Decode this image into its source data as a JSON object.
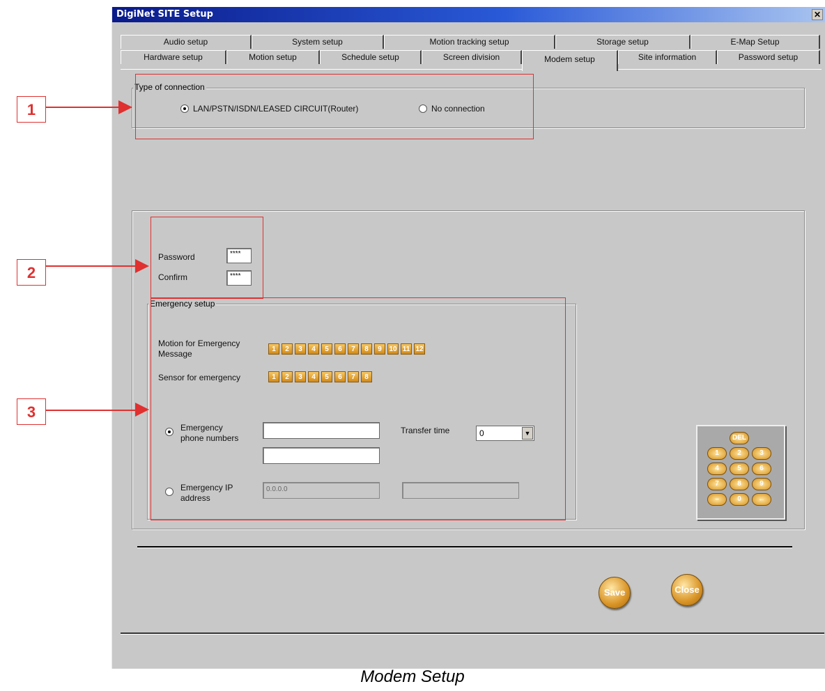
{
  "window": {
    "title": "DigiNet SITE Setup",
    "close_glyph": "✕"
  },
  "tabs_row1": [
    "Audio setup",
    "System setup",
    "Motion tracking setup",
    "Storage setup",
    "E-Map Setup"
  ],
  "tabs_row2": [
    "Hardware setup",
    "Motion setup",
    "Schedule setup",
    "Screen division",
    "Modem setup",
    "Site information",
    "Password setup"
  ],
  "active_tab": "Modem setup",
  "connection": {
    "group_title": "Type of connection",
    "option_lan": "LAN/PSTN/ISDN/LEASED CIRCUIT(Router)",
    "option_none": "No connection",
    "selected": "LAN/PSTN/ISDN/LEASED CIRCUIT(Router)"
  },
  "password": {
    "password_label": "Password",
    "password_value": "****",
    "confirm_label": "Confirm",
    "confirm_value": "****"
  },
  "emergency": {
    "group_title": "Emergency setup",
    "motion_label_1": "Motion for Emergency",
    "motion_label_2": "Message",
    "motion_channels": [
      "1",
      "2",
      "3",
      "4",
      "5",
      "6",
      "7",
      "8",
      "9",
      "10",
      "11",
      "12"
    ],
    "sensor_label": "Sensor for emergency",
    "sensor_channels": [
      "1",
      "2",
      "3",
      "4",
      "5",
      "6",
      "7",
      "8"
    ],
    "phone_label_1": "Emergency",
    "phone_label_2": "phone numbers",
    "phone1": "",
    "phone2": "",
    "transfer_label": "Transfer time",
    "transfer_value": "0",
    "ip_label_1": "Emergency IP",
    "ip_label_2": "address",
    "ip1_value": "0.0.0.0",
    "ip2_value": "",
    "selected": "phone"
  },
  "keypad": {
    "del": "DEL",
    "keys": [
      "1",
      "2",
      "3",
      "4",
      "5",
      "6",
      "7",
      "8",
      "9",
      "–",
      "0",
      "←"
    ]
  },
  "buttons": {
    "save": "Save",
    "close": "Close"
  },
  "callouts": [
    "1",
    "2",
    "3"
  ],
  "caption": "Modem Setup",
  "colors": {
    "title_start": "#0a1a8a",
    "accent_gold": "#d99426",
    "callout_red": "#e03030"
  }
}
